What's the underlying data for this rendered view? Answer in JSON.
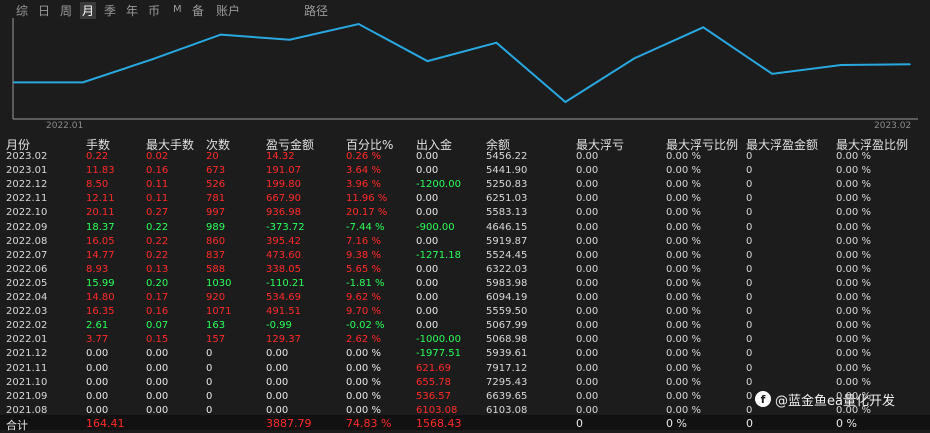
{
  "tabs": [
    {
      "label": "综",
      "active": false
    },
    {
      "label": "日",
      "active": false
    },
    {
      "label": "周",
      "active": false
    },
    {
      "label": "月",
      "active": true
    },
    {
      "label": "季",
      "active": false
    },
    {
      "label": "年",
      "active": false
    },
    {
      "label": "币",
      "active": false
    },
    {
      "label": "M",
      "active": false
    },
    {
      "label": "备",
      "active": false
    },
    {
      "label": "账户",
      "active": false
    },
    {
      "label": "路径",
      "active": false
    }
  ],
  "chart_data": {
    "type": "line",
    "x": [
      "2022.01",
      "2022.02",
      "2022.03",
      "2022.04",
      "2022.05",
      "2022.06",
      "2022.07",
      "2022.08",
      "2022.09",
      "2022.10",
      "2022.11",
      "2022.12",
      "2023.01",
      "2023.02"
    ],
    "values": [
      5068.98,
      5067.99,
      5559.5,
      6094.19,
      5983.98,
      6322.03,
      5524.45,
      5919.87,
      4646.15,
      5583.13,
      6251.03,
      5250.83,
      5441.9,
      5456.22
    ],
    "series_color": "#29a8e0",
    "xlabel_start": "2022.01",
    "xlabel_end": "2023.02"
  },
  "columns": [
    "月份",
    "手数",
    "最大手数",
    "次数",
    "盈亏金额",
    "百分比%",
    "出入金",
    "余额",
    "最大浮亏",
    "最大浮亏比例",
    "最大浮盈金额",
    "最大浮盈比例"
  ],
  "rows": [
    {
      "month": "2023.02",
      "lots": "0.22",
      "max_lots": "0.02",
      "count": "20",
      "pnl": "14.32",
      "pct": "0.26 %",
      "flow": "0.00",
      "bal": "5456.22",
      "mdd": "0.00",
      "mdd_pct": "0.00 %",
      "mfe": "0",
      "mfe_pct": "0.00 %",
      "color": "red",
      "flow_color": "white"
    },
    {
      "month": "2023.01",
      "lots": "11.83",
      "max_lots": "0.16",
      "count": "673",
      "pnl": "191.07",
      "pct": "3.64 %",
      "flow": "0.00",
      "bal": "5441.90",
      "mdd": "0.00",
      "mdd_pct": "0.00 %",
      "mfe": "0",
      "mfe_pct": "0.00 %",
      "color": "red",
      "flow_color": "white"
    },
    {
      "month": "2022.12",
      "lots": "8.50",
      "max_lots": "0.11",
      "count": "526",
      "pnl": "199.80",
      "pct": "3.96 %",
      "flow": "-1200.00",
      "bal": "5250.83",
      "mdd": "0.00",
      "mdd_pct": "0.00 %",
      "mfe": "0",
      "mfe_pct": "0.00 %",
      "color": "red",
      "flow_color": "green"
    },
    {
      "month": "2022.11",
      "lots": "12.11",
      "max_lots": "0.11",
      "count": "781",
      "pnl": "667.90",
      "pct": "11.96 %",
      "flow": "0.00",
      "bal": "6251.03",
      "mdd": "0.00",
      "mdd_pct": "0.00 %",
      "mfe": "0",
      "mfe_pct": "0.00 %",
      "color": "red",
      "flow_color": "white"
    },
    {
      "month": "2022.10",
      "lots": "20.11",
      "max_lots": "0.27",
      "count": "997",
      "pnl": "936.98",
      "pct": "20.17 %",
      "flow": "0.00",
      "bal": "5583.13",
      "mdd": "0.00",
      "mdd_pct": "0.00 %",
      "mfe": "0",
      "mfe_pct": "0.00 %",
      "color": "red",
      "flow_color": "white"
    },
    {
      "month": "2022.09",
      "lots": "18.37",
      "max_lots": "0.22",
      "count": "989",
      "pnl": "-373.72",
      "pct": "-7.44 %",
      "flow": "-900.00",
      "bal": "4646.15",
      "mdd": "0.00",
      "mdd_pct": "0.00 %",
      "mfe": "0",
      "mfe_pct": "0.00 %",
      "color": "green",
      "flow_color": "green"
    },
    {
      "month": "2022.08",
      "lots": "16.05",
      "max_lots": "0.22",
      "count": "860",
      "pnl": "395.42",
      "pct": "7.16 %",
      "flow": "0.00",
      "bal": "5919.87",
      "mdd": "0.00",
      "mdd_pct": "0.00 %",
      "mfe": "0",
      "mfe_pct": "0.00 %",
      "color": "red",
      "flow_color": "white"
    },
    {
      "month": "2022.07",
      "lots": "14.77",
      "max_lots": "0.22",
      "count": "837",
      "pnl": "473.60",
      "pct": "9.38 %",
      "flow": "-1271.18",
      "bal": "5524.45",
      "mdd": "0.00",
      "mdd_pct": "0.00 %",
      "mfe": "0",
      "mfe_pct": "0.00 %",
      "color": "red",
      "flow_color": "green"
    },
    {
      "month": "2022.06",
      "lots": "8.93",
      "max_lots": "0.13",
      "count": "588",
      "pnl": "338.05",
      "pct": "5.65 %",
      "flow": "0.00",
      "bal": "6322.03",
      "mdd": "0.00",
      "mdd_pct": "0.00 %",
      "mfe": "0",
      "mfe_pct": "0.00 %",
      "color": "red",
      "flow_color": "white"
    },
    {
      "month": "2022.05",
      "lots": "15.99",
      "max_lots": "0.20",
      "count": "1030",
      "pnl": "-110.21",
      "pct": "-1.81 %",
      "flow": "0.00",
      "bal": "5983.98",
      "mdd": "0.00",
      "mdd_pct": "0.00 %",
      "mfe": "0",
      "mfe_pct": "0.00 %",
      "color": "green",
      "flow_color": "white"
    },
    {
      "month": "2022.04",
      "lots": "14.80",
      "max_lots": "0.17",
      "count": "920",
      "pnl": "534.69",
      "pct": "9.62 %",
      "flow": "0.00",
      "bal": "6094.19",
      "mdd": "0.00",
      "mdd_pct": "0.00 %",
      "mfe": "0",
      "mfe_pct": "0.00 %",
      "color": "red",
      "flow_color": "white"
    },
    {
      "month": "2022.03",
      "lots": "16.35",
      "max_lots": "0.16",
      "count": "1071",
      "pnl": "491.51",
      "pct": "9.70 %",
      "flow": "0.00",
      "bal": "5559.50",
      "mdd": "0.00",
      "mdd_pct": "0.00 %",
      "mfe": "0",
      "mfe_pct": "0.00 %",
      "color": "red",
      "flow_color": "white"
    },
    {
      "month": "2022.02",
      "lots": "2.61",
      "max_lots": "0.07",
      "count": "163",
      "pnl": "-0.99",
      "pct": "-0.02 %",
      "flow": "0.00",
      "bal": "5067.99",
      "mdd": "0.00",
      "mdd_pct": "0.00 %",
      "mfe": "0",
      "mfe_pct": "0.00 %",
      "color": "green",
      "flow_color": "white"
    },
    {
      "month": "2022.01",
      "lots": "3.77",
      "max_lots": "0.15",
      "count": "157",
      "pnl": "129.37",
      "pct": "2.62 %",
      "flow": "-1000.00",
      "bal": "5068.98",
      "mdd": "0.00",
      "mdd_pct": "0.00 %",
      "mfe": "0",
      "mfe_pct": "0.00 %",
      "color": "red",
      "flow_color": "green"
    },
    {
      "month": "2021.12",
      "lots": "0.00",
      "max_lots": "0.00",
      "count": "0",
      "pnl": "0.00",
      "pct": "0.00 %",
      "flow": "-1977.51",
      "bal": "5939.61",
      "mdd": "0.00",
      "mdd_pct": "0.00 %",
      "mfe": "0",
      "mfe_pct": "0.00 %",
      "color": "white",
      "flow_color": "green"
    },
    {
      "month": "2021.11",
      "lots": "0.00",
      "max_lots": "0.00",
      "count": "0",
      "pnl": "0.00",
      "pct": "0.00 %",
      "flow": "621.69",
      "bal": "7917.12",
      "mdd": "0.00",
      "mdd_pct": "0.00 %",
      "mfe": "0",
      "mfe_pct": "0.00 %",
      "color": "white",
      "flow_color": "red"
    },
    {
      "month": "2021.10",
      "lots": "0.00",
      "max_lots": "0.00",
      "count": "0",
      "pnl": "0.00",
      "pct": "0.00 %",
      "flow": "655.78",
      "bal": "7295.43",
      "mdd": "0.00",
      "mdd_pct": "0.00 %",
      "mfe": "0",
      "mfe_pct": "0.00 %",
      "color": "white",
      "flow_color": "red"
    },
    {
      "month": "2021.09",
      "lots": "0.00",
      "max_lots": "0.00",
      "count": "0",
      "pnl": "0.00",
      "pct": "0.00 %",
      "flow": "536.57",
      "bal": "6639.65",
      "mdd": "0.00",
      "mdd_pct": "0.00 %",
      "mfe": "0",
      "mfe_pct": "0.00 %",
      "color": "white",
      "flow_color": "red"
    },
    {
      "month": "2021.08",
      "lots": "0.00",
      "max_lots": "0.00",
      "count": "0",
      "pnl": "0.00",
      "pct": "0.00 %",
      "flow": "6103.08",
      "bal": "6103.08",
      "mdd": "0.00",
      "mdd_pct": "0.00 %",
      "mfe": "0",
      "mfe_pct": "0.00 %",
      "color": "white",
      "flow_color": "red"
    }
  ],
  "total": {
    "label": "合计",
    "lots": "164.41",
    "pnl": "3887.79",
    "pct": "74.83 %",
    "flow": "1568.43",
    "mdd": "0",
    "mdd_pct": "0 %",
    "mfe": "0",
    "mfe_pct": "0 %"
  },
  "watermark": {
    "text": "@蓝金鱼ea量化开发"
  }
}
